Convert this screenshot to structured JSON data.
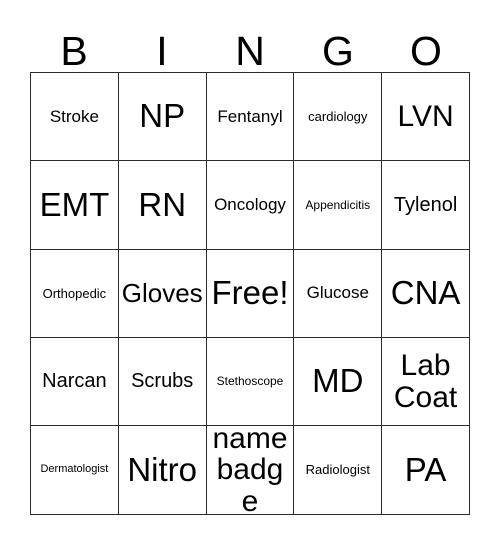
{
  "card": {
    "title": "Bingo Card",
    "header_letters": [
      "B",
      "I",
      "N",
      "G",
      "O"
    ],
    "columns": 5,
    "rows": 5,
    "free_space": "Free!",
    "colors": {
      "background": "#ffffff",
      "text": "#000000",
      "grid_line": "#2b2b2b"
    },
    "cells": [
      [
        {
          "label": "Stroke",
          "size": "md"
        },
        {
          "label": "NP",
          "size": "huge"
        },
        {
          "label": "Fentanyl",
          "size": "md"
        },
        {
          "label": "cardiology",
          "size": "smd"
        },
        {
          "label": "LVN",
          "size": "xxl"
        }
      ],
      [
        {
          "label": "EMT",
          "size": "huge"
        },
        {
          "label": "RN",
          "size": "huge"
        },
        {
          "label": "Oncology",
          "size": "md"
        },
        {
          "label": "Appendicitis",
          "size": "sm"
        },
        {
          "label": "Tylenol",
          "size": "lg"
        }
      ],
      [
        {
          "label": "Orthopedic",
          "size": "smd"
        },
        {
          "label": "Gloves",
          "size": "xl"
        },
        {
          "label": "Free!",
          "size": "huge"
        },
        {
          "label": "Glucose",
          "size": "md"
        },
        {
          "label": "CNA",
          "size": "huge"
        }
      ],
      [
        {
          "label": "Narcan",
          "size": "lg"
        },
        {
          "label": "Scrubs",
          "size": "lg"
        },
        {
          "label": "Stethoscope",
          "size": "sm"
        },
        {
          "label": "MD",
          "size": "huge"
        },
        {
          "label": "Lab Coat",
          "size": "xxl"
        }
      ],
      [
        {
          "label": "Dermatologist",
          "size": "xs"
        },
        {
          "label": "Nitro",
          "size": "huge"
        },
        {
          "label": "name badge",
          "size": "xxl"
        },
        {
          "label": "Radiologist",
          "size": "smd"
        },
        {
          "label": "PA",
          "size": "huge"
        }
      ]
    ]
  }
}
